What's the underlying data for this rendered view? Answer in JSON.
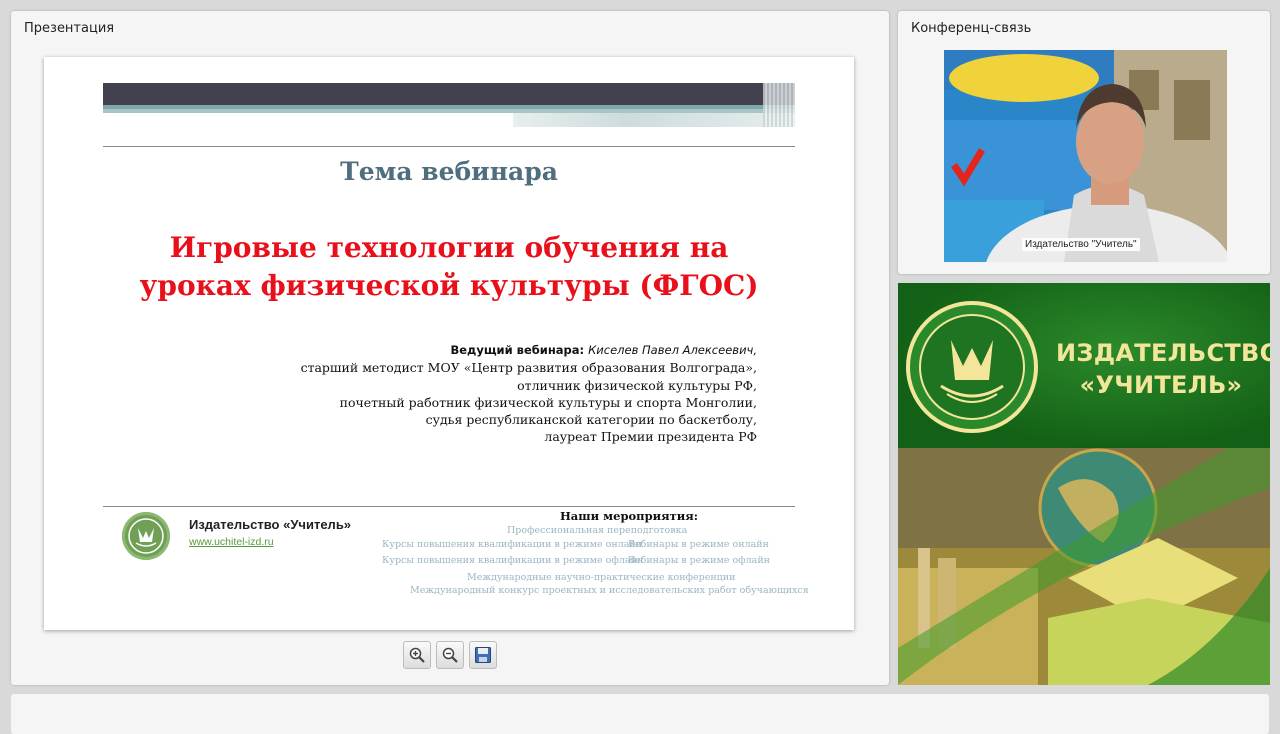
{
  "presentation_panel": {
    "title": "Презентация",
    "slide": {
      "heading": "Тема вебинара",
      "main_title_line1": "Игровые технологии обучения на",
      "main_title_line2": "уроках физической культуры (ФГОС)",
      "presenter_lead": "Ведущий вебинара:",
      "presenter_name": "Киселев Павел Алексеевич,",
      "presenter_lines": [
        "старший методист МОУ «Центр развития образования Волгограда»,",
        "отличник физической культуры РФ,",
        "почетный работник физической культуры и спорта Монголии,",
        "судья республиканской категории по баскетболу,",
        "лауреат Премии президента РФ"
      ],
      "footer_brand": "Издательство «Учитель»",
      "footer_url": "www.uchitel-izd.ru",
      "events_title": "Наши мероприятия:",
      "events": [
        "Профессиональная переподготовка",
        "Курсы повышения квалификации в режиме онлайн",
        "Вебинары в режиме онлайн",
        "Курсы повышения квалификации в режиме офлайн",
        "Вебинары в режиме офлайн",
        "Международные научно-практические конференции",
        "Международный конкурс проектных и исследовательских работ обучающихся"
      ]
    },
    "toolbar": {
      "zoom_in_icon": "zoom-in-icon",
      "zoom_out_icon": "zoom-out-icon",
      "save_icon": "save-icon"
    }
  },
  "conference_panel": {
    "title": "Конференц-связь",
    "video_label": "Издательство \"Учитель\""
  },
  "ad_banner": {
    "line1": "ИЗДАТЕЛЬСТВО",
    "line2": "«УЧИТЕЛЬ»",
    "colors": {
      "green": "#1d6a1f",
      "text": "#f3e59a"
    }
  }
}
